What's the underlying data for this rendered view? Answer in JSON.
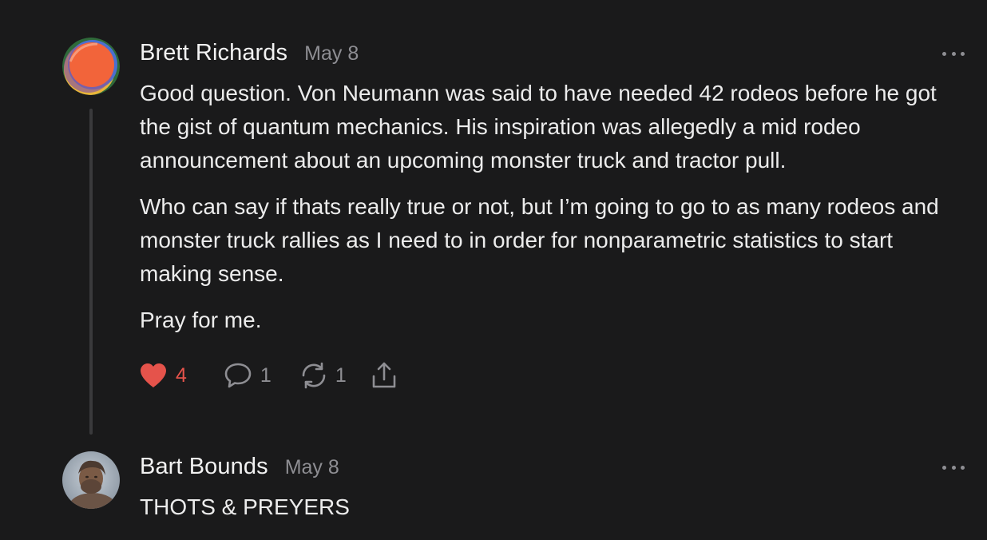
{
  "comments": [
    {
      "author": "Brett Richards",
      "date": "May 8",
      "avatar_icon": "abstract-orange-avatar",
      "paragraphs": [
        "Good question. Von Neumann was said to have needed 42 rodeos before he got the gist of quantum mechanics. His inspiration was allegedly a mid rodeo announcement about an upcoming monster truck and tractor pull.",
        "Who can say if thats really true or not, but I’m going to go to as many rodeos and monster truck rallies as I need to in order for nonparametric statistics to start making sense.",
        "Pray for me."
      ],
      "actions": {
        "likes": "4",
        "replies": "1",
        "restacks": "1",
        "share_icon": "share-icon"
      },
      "colors": {
        "like": "#e5534b",
        "muted": "#8e8e93"
      }
    },
    {
      "author": "Bart Bounds",
      "date": "May 8",
      "avatar_icon": "caveman-photo-avatar",
      "paragraphs": [
        "THOTS & PREYERS"
      ]
    }
  ]
}
